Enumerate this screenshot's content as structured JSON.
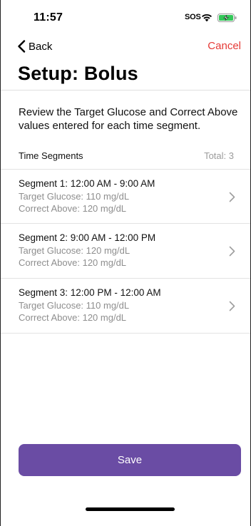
{
  "status_bar": {
    "time": "11:57",
    "sos": "SOS",
    "wifi_icon": "wifi-icon",
    "battery_icon": "battery-charging-icon",
    "battery_color": "#34c759"
  },
  "nav": {
    "back_label": "Back",
    "back_icon": "chevron-left-icon",
    "cancel_label": "Cancel",
    "cancel_color": "#e53935"
  },
  "page": {
    "title": "Setup: Bolus",
    "intro": "Review the Target Glucose and Correct Above values entered for each time segment."
  },
  "segments_header": {
    "title": "Time Segments",
    "total": "Total: 3"
  },
  "segments": [
    {
      "name": "Segment 1: 12:00 AM - 9:00 AM",
      "target_glucose": "Target Glucose: 110 mg/dL",
      "correct_above": "Correct Above: 120 mg/dL"
    },
    {
      "name": "Segment 2: 9:00 AM - 12:00 PM",
      "target_glucose": "Target Glucose: 120 mg/dL",
      "correct_above": "Correct Above: 120 mg/dL"
    },
    {
      "name": "Segment 3: 12:00 PM - 12:00 AM",
      "target_glucose": "Target Glucose: 110 mg/dL",
      "correct_above": "Correct Above: 120 mg/dL"
    }
  ],
  "footer": {
    "save_label": "Save",
    "save_color": "#6a4ca4"
  }
}
